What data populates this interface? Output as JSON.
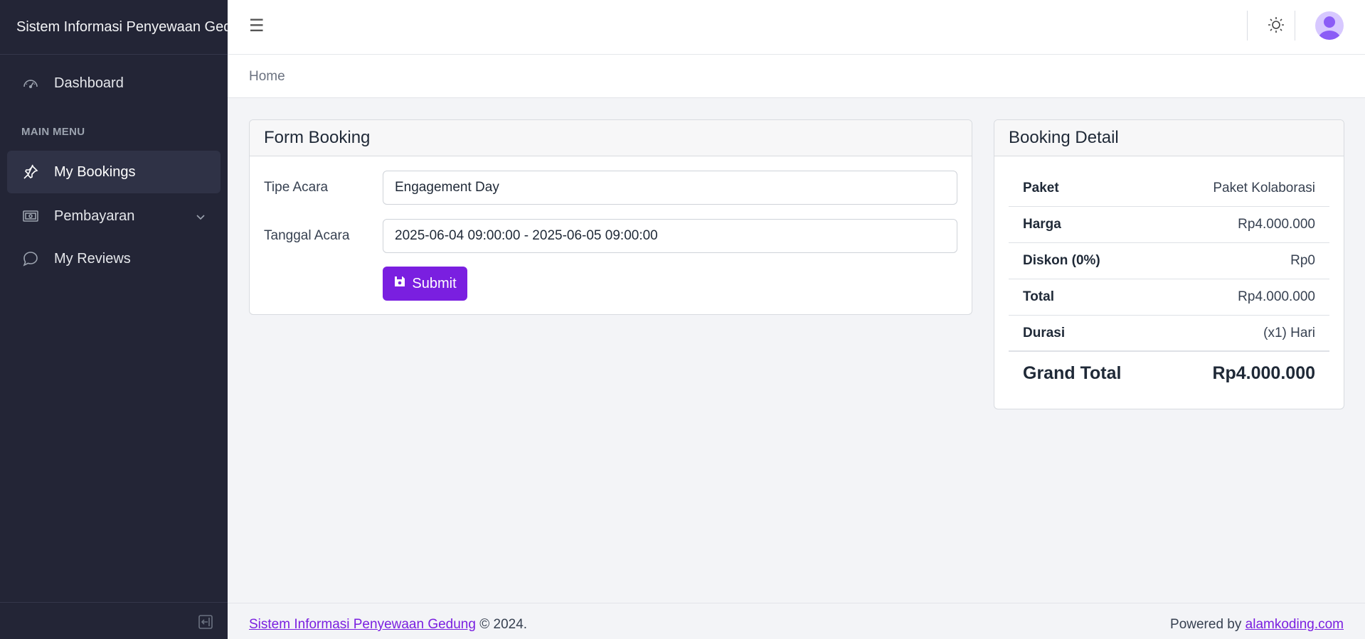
{
  "app": {
    "title": "Sistem Informasi Penyewaan Gedung"
  },
  "sidebar": {
    "dashboard": "Dashboard",
    "section_label": "MAIN MENU",
    "items": [
      {
        "label": "My Bookings",
        "icon": "pin-icon",
        "active": true
      },
      {
        "label": "Pembayaran",
        "icon": "receipt-icon",
        "active": false
      },
      {
        "label": "My Reviews",
        "icon": "chat-icon",
        "active": false
      }
    ]
  },
  "breadcrumb": {
    "home": "Home"
  },
  "form": {
    "title": "Form Booking",
    "fields": [
      {
        "label": "Tipe Acara",
        "value": "Engagement Day"
      },
      {
        "label": "Tanggal Acara",
        "value": "2025-06-04 09:00:00 - 2025-06-05 09:00:00"
      }
    ],
    "submit_label": "Submit"
  },
  "detail": {
    "title": "Booking Detail",
    "rows": [
      {
        "key": "Paket",
        "value": "Paket Kolaborasi"
      },
      {
        "key": "Harga",
        "value": "Rp4.000.000"
      },
      {
        "key": "Diskon (0%)",
        "value": "Rp0"
      },
      {
        "key": "Total",
        "value": "Rp4.000.000"
      },
      {
        "key": "Durasi",
        "value": "(x1) Hari"
      }
    ],
    "grand_total_label": "Grand Total",
    "grand_total_value": "Rp4.000.000"
  },
  "footer": {
    "link": "Sistem Informasi Penyewaan Gedung",
    "copyright": "© 2024.",
    "powered_by": "Powered by",
    "powered_link": "alamkoding.com"
  },
  "colors": {
    "accent": "#7a1fe0",
    "sidebar_bg": "#232536",
    "page_bg": "#f3f4f7"
  }
}
